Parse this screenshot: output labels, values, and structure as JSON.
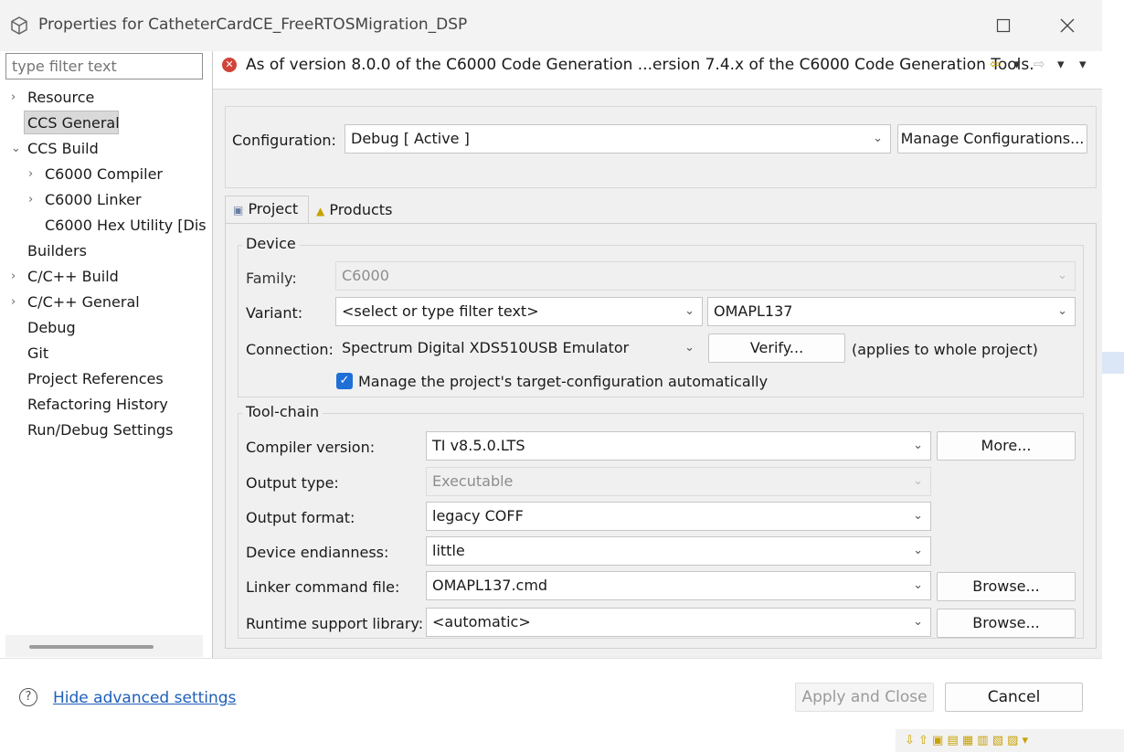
{
  "window": {
    "title": "Properties for CatheterCardCE_FreeRTOSMigration_DSP",
    "app_icon": "cube-icon",
    "maximize_icon": "maximize-icon",
    "close_icon": "close-icon"
  },
  "filter": {
    "placeholder": "type filter text"
  },
  "nav": {
    "items": [
      {
        "label": "Resource",
        "expander": "›"
      },
      {
        "label": "CCS General",
        "expander": ""
      },
      {
        "label": "CCS Build",
        "expander": "⌄"
      },
      {
        "label": "C6000 Compiler",
        "expander": "›"
      },
      {
        "label": "C6000 Linker",
        "expander": "›"
      },
      {
        "label": "C6000 Hex Utility  [Dis",
        "expander": ""
      },
      {
        "label": "Builders",
        "expander": ""
      },
      {
        "label": "C/C++ Build",
        "expander": "›"
      },
      {
        "label": "C/C++ General",
        "expander": "›"
      },
      {
        "label": "Debug",
        "expander": ""
      },
      {
        "label": "Git",
        "expander": ""
      },
      {
        "label": "Project References",
        "expander": ""
      },
      {
        "label": "Refactoring History",
        "expander": ""
      },
      {
        "label": "Run/Debug Settings",
        "expander": ""
      }
    ]
  },
  "message": {
    "text": "As of version 8.0.0 of the C6000 Code Generation ...ersion 7.4.x of the C6000 Code Generation Tools.",
    "icon": "error-icon",
    "back_glyph": "⇦",
    "forward_glyph": "⇨",
    "menu_glyph": "▾"
  },
  "config": {
    "label": "Configuration:",
    "value": "Debug  [ Active ]",
    "manage_label": "Manage Configurations..."
  },
  "tabs": [
    {
      "label": "Project",
      "icon": "project-icon"
    },
    {
      "label": "Products",
      "icon": "products-icon"
    }
  ],
  "device": {
    "title": "Device",
    "family_label": "Family:",
    "family_value": "C6000",
    "variant_label": "Variant:",
    "variant_filter": "<select or type filter text>",
    "variant_value": "OMAPL137",
    "connection_label": "Connection:",
    "connection_value": "Spectrum Digital XDS510USB Emulator",
    "verify_label": "Verify...",
    "applies_text": "(applies to whole project)",
    "manage_target_label": "Manage the project's target-configuration automatically"
  },
  "toolchain": {
    "title": "Tool-chain",
    "compiler_label": "Compiler version:",
    "compiler_value": "TI v8.5.0.LTS",
    "more_label": "More...",
    "output_type_label": "Output type:",
    "output_type_value": "Executable",
    "output_format_label": "Output format:",
    "output_format_value": "legacy COFF",
    "endianness_label": "Device endianness:",
    "endianness_value": "little",
    "linker_label": "Linker command file:",
    "linker_value": "OMAPL137.cmd",
    "browse_label": "Browse...",
    "runtime_label": "Runtime support library:",
    "runtime_value": "<automatic>",
    "browse2_label": "Browse..."
  },
  "footer": {
    "help_icon": "help-icon",
    "hide_advanced_label": "Hide advanced settings",
    "apply_close_label": "Apply and Close",
    "cancel_label": "Cancel"
  },
  "colors": {
    "accent": "#1f6fd6",
    "error": "#d0443a",
    "link": "#1f5fb8"
  }
}
